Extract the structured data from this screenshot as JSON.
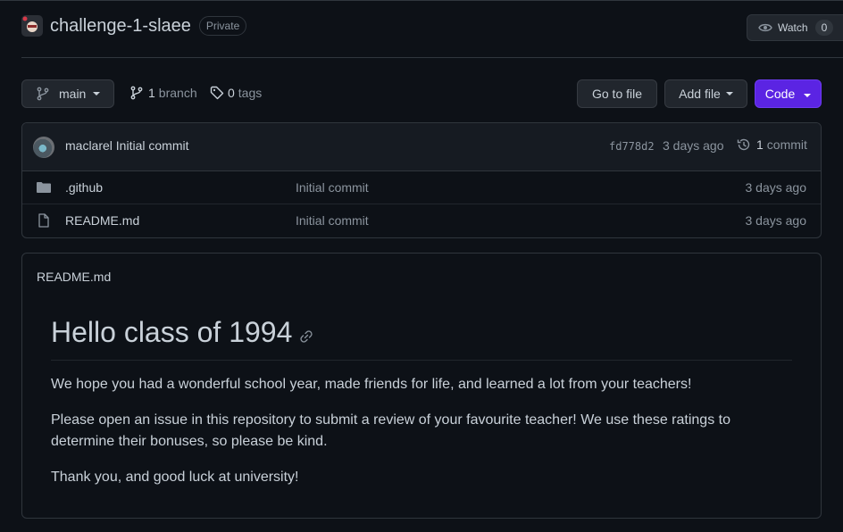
{
  "repo": {
    "name": "challenge-1-slaee",
    "visibility": "Private",
    "watch_label": "Watch",
    "watch_count": "0"
  },
  "toolbar": {
    "branch_name": "main",
    "branch_count": "1",
    "branch_label": "branch",
    "tag_count": "0",
    "tag_label": "tags",
    "goto_label": "Go to file",
    "addfile_label": "Add file",
    "code_label": "Code"
  },
  "latest_commit": {
    "author": "maclarel",
    "message": "Initial commit",
    "sha": "fd778d2",
    "age": "3 days ago",
    "count": "1",
    "count_label": "commit"
  },
  "files": [
    {
      "name": ".github",
      "type": "folder",
      "commit": "Initial commit",
      "age": "3 days ago"
    },
    {
      "name": "README.md",
      "type": "file",
      "commit": "Initial commit",
      "age": "3 days ago"
    }
  ],
  "readme": {
    "filename": "README.md",
    "heading": "Hello class of 1994",
    "paragraphs": [
      "We hope you had a wonderful school year, made friends for life, and learned a lot from your teachers!",
      "Please open an issue in this repository to submit a review of your favourite teacher! We use these ratings to determine their bonuses, so please be kind.",
      "Thank you, and good luck at university!"
    ]
  },
  "colors": {
    "background": "#0d1117",
    "border": "#30363d",
    "code_button": "#5b24e3"
  }
}
